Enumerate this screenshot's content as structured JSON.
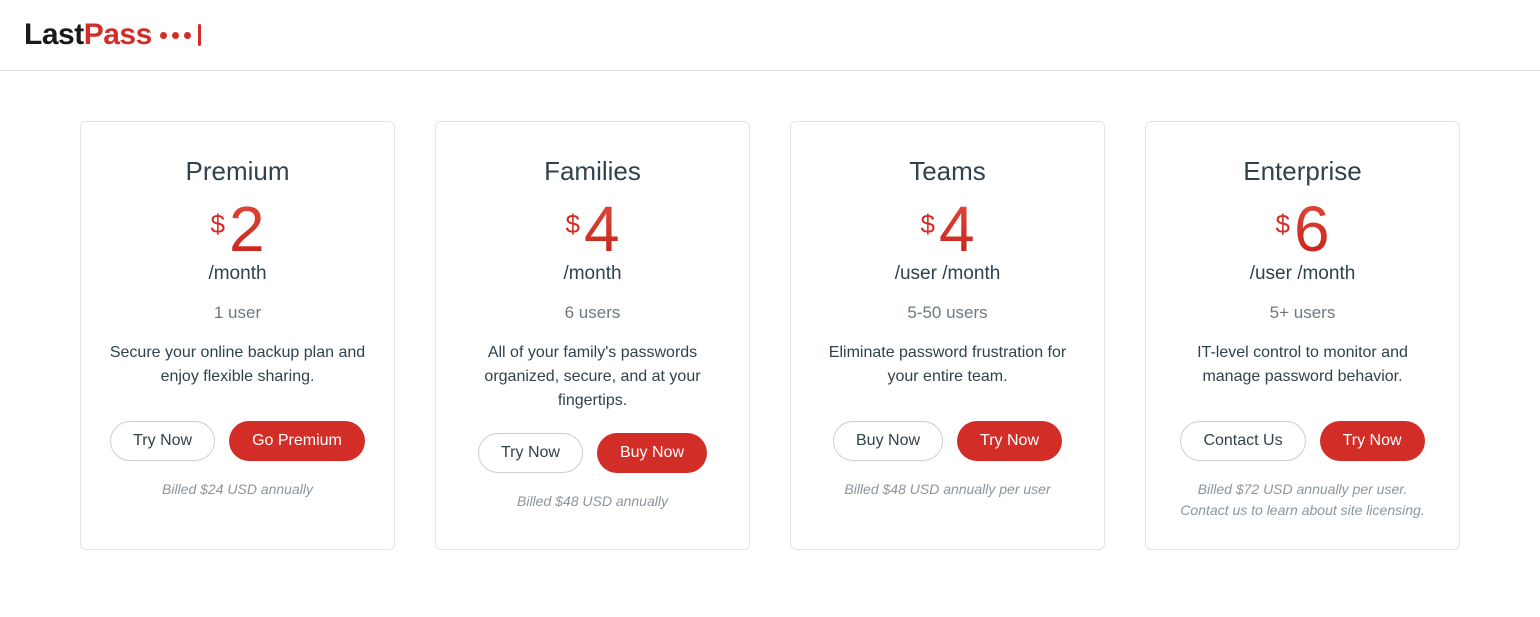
{
  "brand": {
    "part1": "Last",
    "part2": "Pass"
  },
  "plans": [
    {
      "name": "Premium",
      "currency": "$",
      "amount": "2",
      "period": "/month",
      "users": "1 user",
      "desc": "Secure your online backup plan and enjoy flexible sharing.",
      "btn1": "Try Now",
      "btn2": "Go Premium",
      "billed": "Billed $24 USD annually"
    },
    {
      "name": "Families",
      "currency": "$",
      "amount": "4",
      "period": "/month",
      "users": "6 users",
      "desc": "All of your family's passwords organized, secure, and at your fingertips.",
      "btn1": "Try Now",
      "btn2": "Buy Now",
      "billed": "Billed $48 USD annually"
    },
    {
      "name": "Teams",
      "currency": "$",
      "amount": "4",
      "period": "/user  /month",
      "users": "5-50 users",
      "desc": "Eliminate password frustration for your entire team.",
      "btn1": "Buy Now",
      "btn2": "Try Now",
      "billed": "Billed $48 USD annually per user"
    },
    {
      "name": "Enterprise",
      "currency": "$",
      "amount": "6",
      "period": "/user  /month",
      "users": "5+ users",
      "desc": "IT-level control to monitor and manage password behavior.",
      "btn1": "Contact Us",
      "btn2": "Try Now",
      "billed": "Billed $72 USD annually per user. Contact us to learn about site licensing."
    }
  ]
}
